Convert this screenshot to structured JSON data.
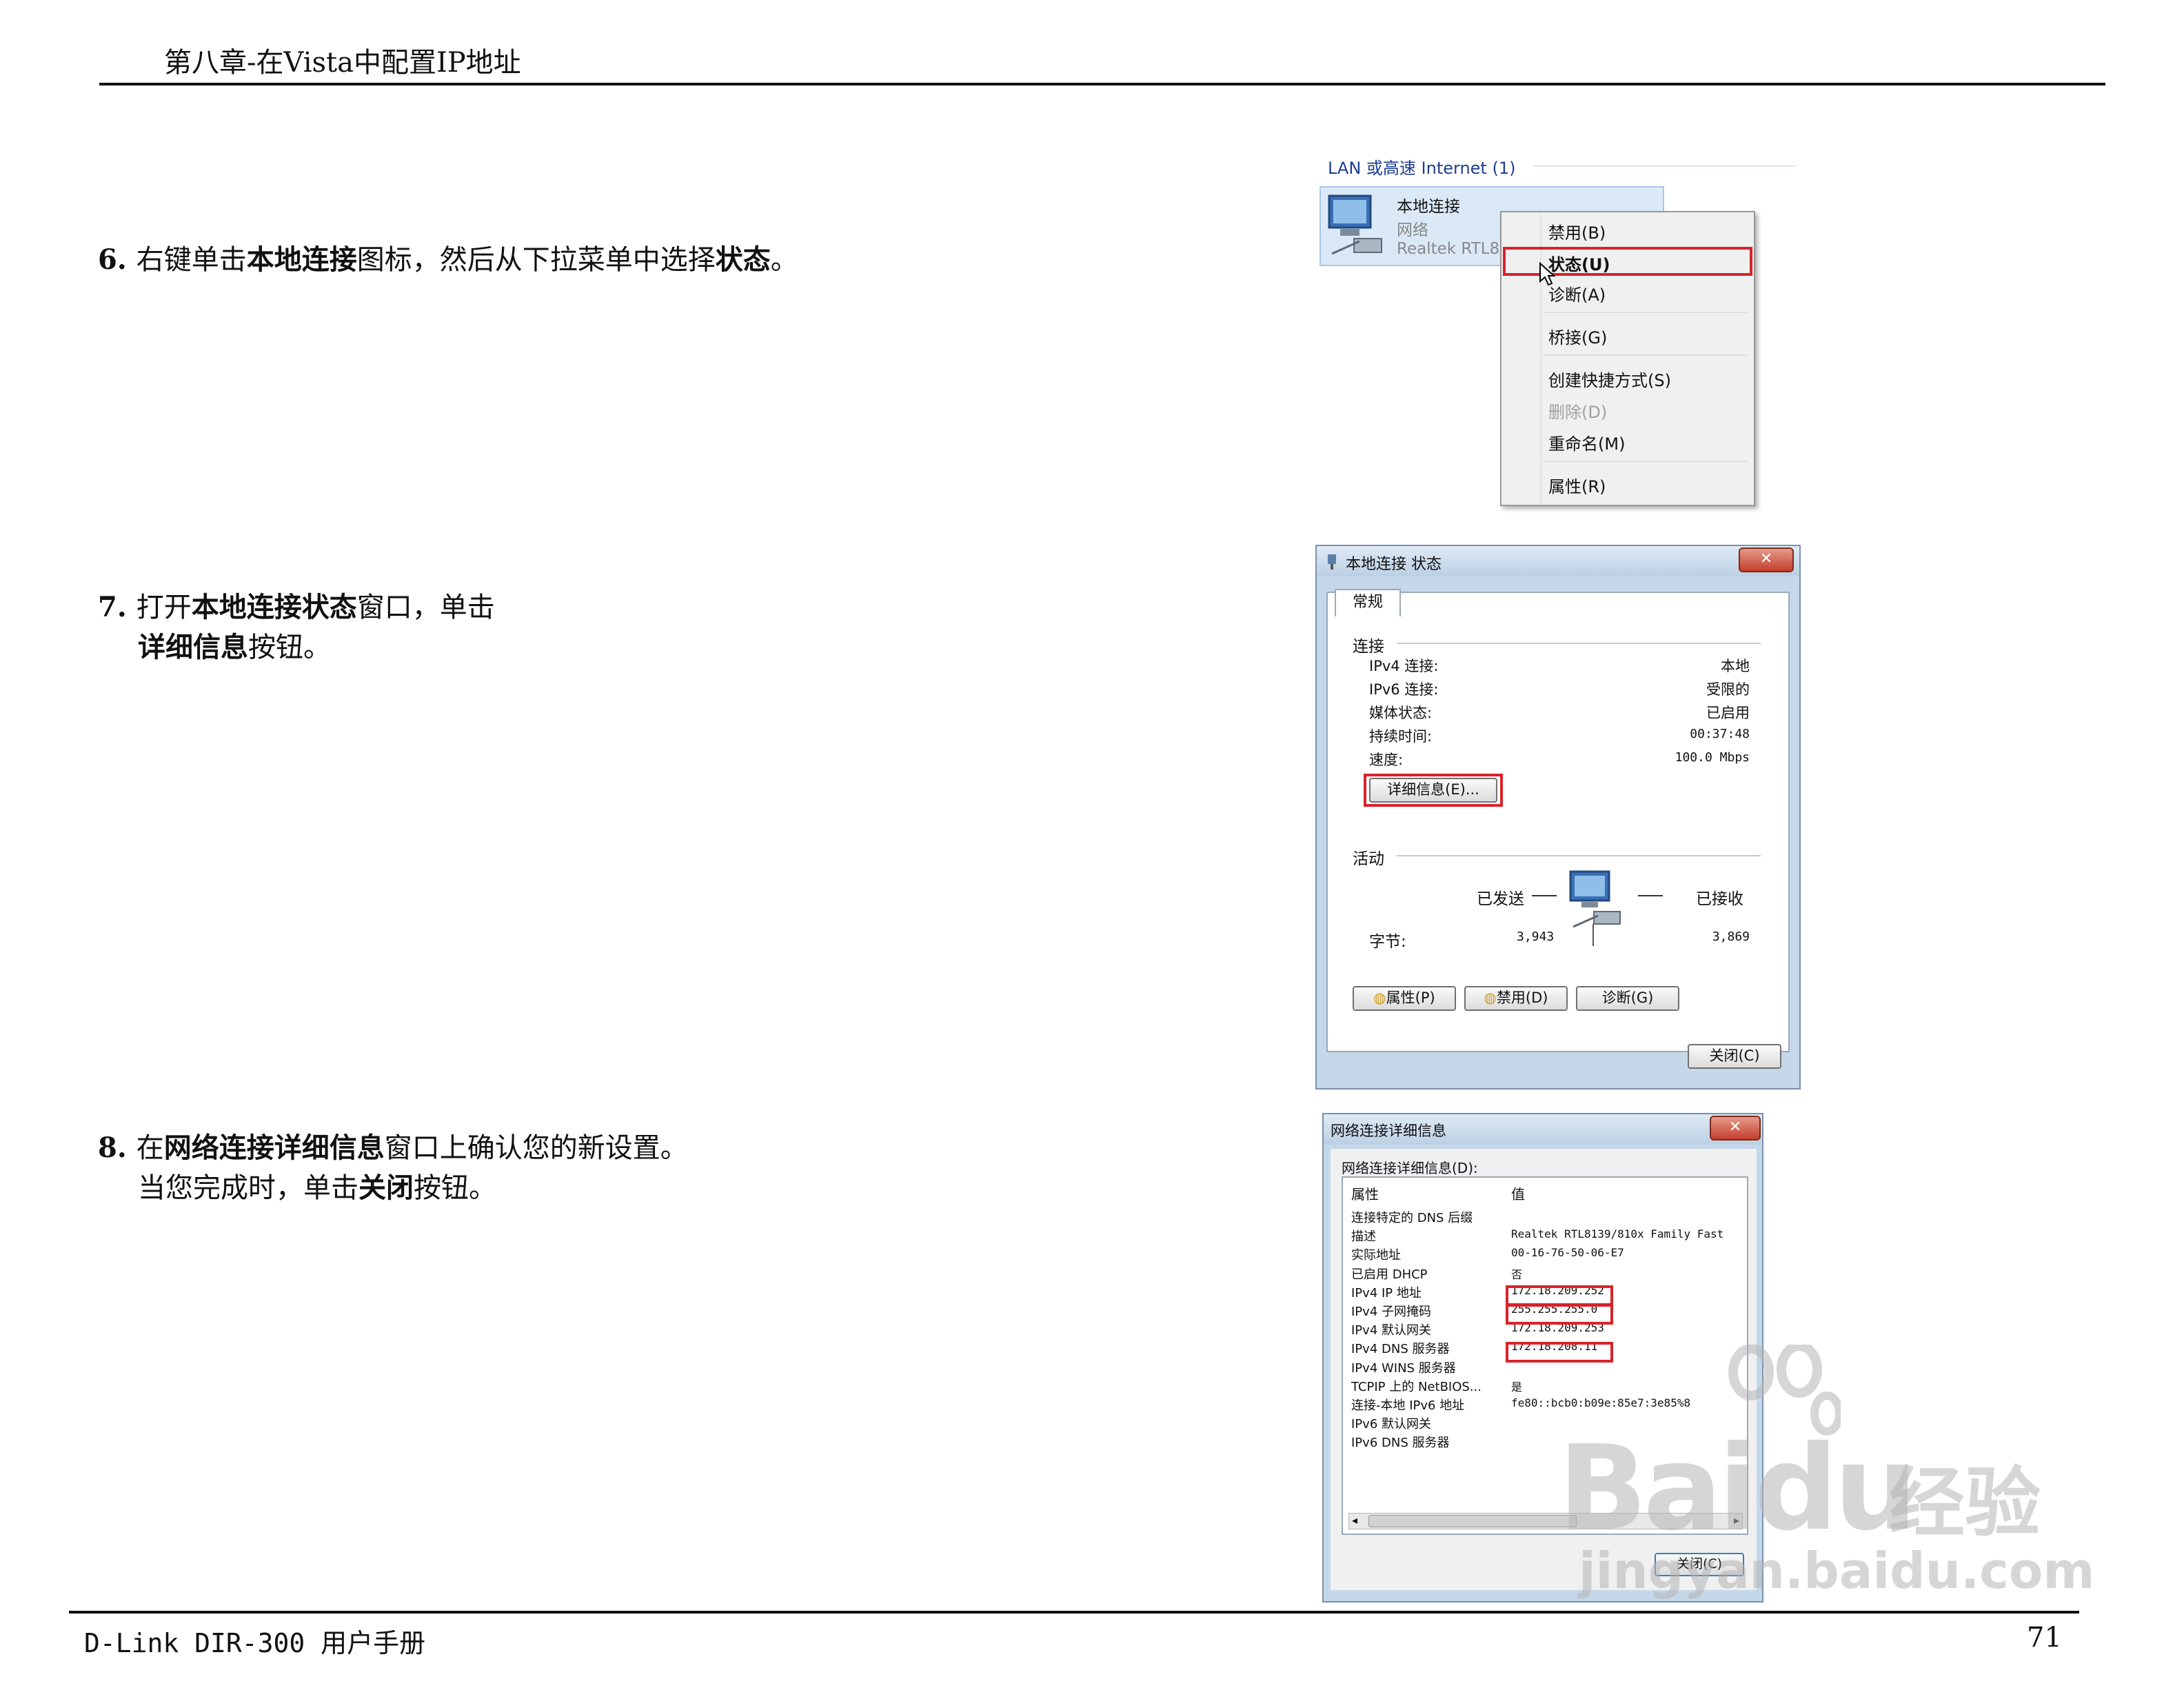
{
  "header": {
    "title": "第八章-在Vista中配置IP地址"
  },
  "footer": {
    "manual": "D-Link DIR-300 用户手册",
    "page_number": "71"
  },
  "steps": [
    {
      "num": "6.",
      "t1": "右键单击",
      "b1": "本地连接",
      "t2": "图标，然后从下拉菜单中选择",
      "b2": "状态",
      "t3": "。"
    },
    {
      "num": "7.",
      "t1": "打开",
      "b1": "本地连接状态",
      "t2": "窗口，单击",
      "b2": "详细信息",
      "t3": "按钮。"
    },
    {
      "num": "8.",
      "t1": "在",
      "b1": "网络连接详细信息",
      "t2": "窗口上确认您的新设置。",
      "line2a": "当您完成时，单击",
      "b2": "关闭",
      "t3": "按钮。"
    }
  ],
  "screenshot1": {
    "group_label": "LAN 或高速 Internet (1)",
    "conn_name": "本地连接",
    "conn_type": "网络",
    "conn_adapter": "Realtek RTL8",
    "menu": [
      "禁用(B)",
      "状态(U)",
      "诊断(A)",
      "桥接(G)",
      "创建快捷方式(S)",
      "删除(D)",
      "重命名(M)",
      "属性(R)"
    ]
  },
  "screenshot2": {
    "title": "本地连接 状态",
    "tab": "常规",
    "section_conn": "连接",
    "rows": [
      {
        "k": "IPv4 连接:",
        "v": "本地"
      },
      {
        "k": "IPv6 连接:",
        "v": "受限的"
      },
      {
        "k": "媒体状态:",
        "v": "已启用"
      },
      {
        "k": "持续时间:",
        "v": "00:37:48"
      },
      {
        "k": "速度:",
        "v": "100.0 Mbps"
      }
    ],
    "details_btn": "详细信息(E)...",
    "section_activity": "活动",
    "sent": "已发送",
    "received": "已接收",
    "bytes_label": "字节:",
    "bytes_sent": "3,943",
    "bytes_recv": "3,869",
    "btn_props": "属性(P)",
    "btn_disable": "禁用(D)",
    "btn_diag": "诊断(G)",
    "btn_close": "关闭(C)"
  },
  "screenshot3": {
    "title": "网络连接详细信息",
    "label": "网络连接详细信息(D):",
    "col_prop": "属性",
    "col_val": "值",
    "rows": [
      {
        "k": "连接特定的 DNS 后缀",
        "v": ""
      },
      {
        "k": "描述",
        "v": "Realtek RTL8139/810x Family Fast"
      },
      {
        "k": "实际地址",
        "v": "00-16-76-50-06-E7"
      },
      {
        "k": "已启用 DHCP",
        "v": "否"
      },
      {
        "k": "IPv4 IP 地址",
        "v": "172.18.209.252"
      },
      {
        "k": "IPv4 子网掩码",
        "v": "255.255.255.0"
      },
      {
        "k": "IPv4 默认网关",
        "v": "172.18.209.253"
      },
      {
        "k": "IPv4 DNS 服务器",
        "v": "172.18.208.11"
      },
      {
        "k": "IPv4 WINS 服务器",
        "v": ""
      },
      {
        "k": "TCPIP 上的 NetBIOS...",
        "v": "是"
      },
      {
        "k": "连接-本地 IPv6 地址",
        "v": "fe80::bcb0:b09e:85e7:3e85%8"
      },
      {
        "k": "IPv6 默认网关",
        "v": ""
      },
      {
        "k": "IPv6 DNS 服务器",
        "v": ""
      }
    ],
    "btn_close": "关闭(C)"
  },
  "watermark": {
    "brand": "Bai",
    "brand2": "du",
    "cn": "经验",
    "url": "jingyan.baidu.com"
  }
}
